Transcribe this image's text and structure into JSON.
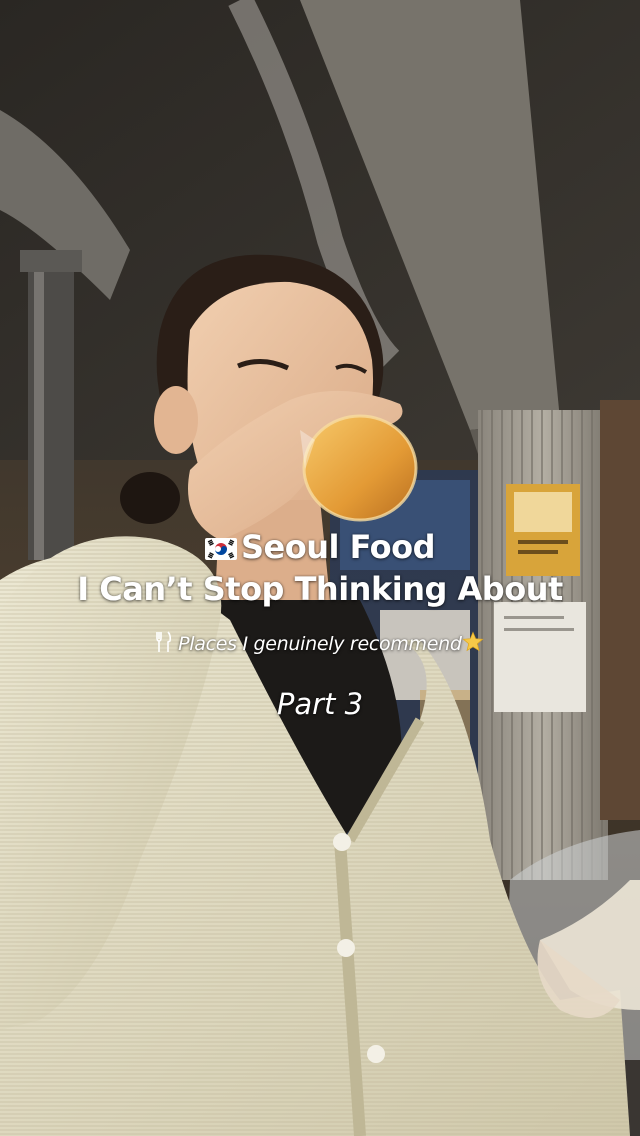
{
  "overlay": {
    "title_line_1": "Seoul Food",
    "title_line_2": "I Can’t Stop Thinking About",
    "subtitle": "Places I genuinely recommend",
    "part_label": "Part 3",
    "icons": {
      "title_prefix": "south-korea-flag-icon",
      "subtitle_prefix": "fork-and-knife-icon",
      "subtitle_suffix": "star-icon"
    }
  },
  "colors": {
    "caption_text": "#ffffff",
    "star": "#f7c948",
    "cardigan": "#e6e1c8",
    "top": "#1c1a18",
    "drink": "#e8a53c"
  }
}
